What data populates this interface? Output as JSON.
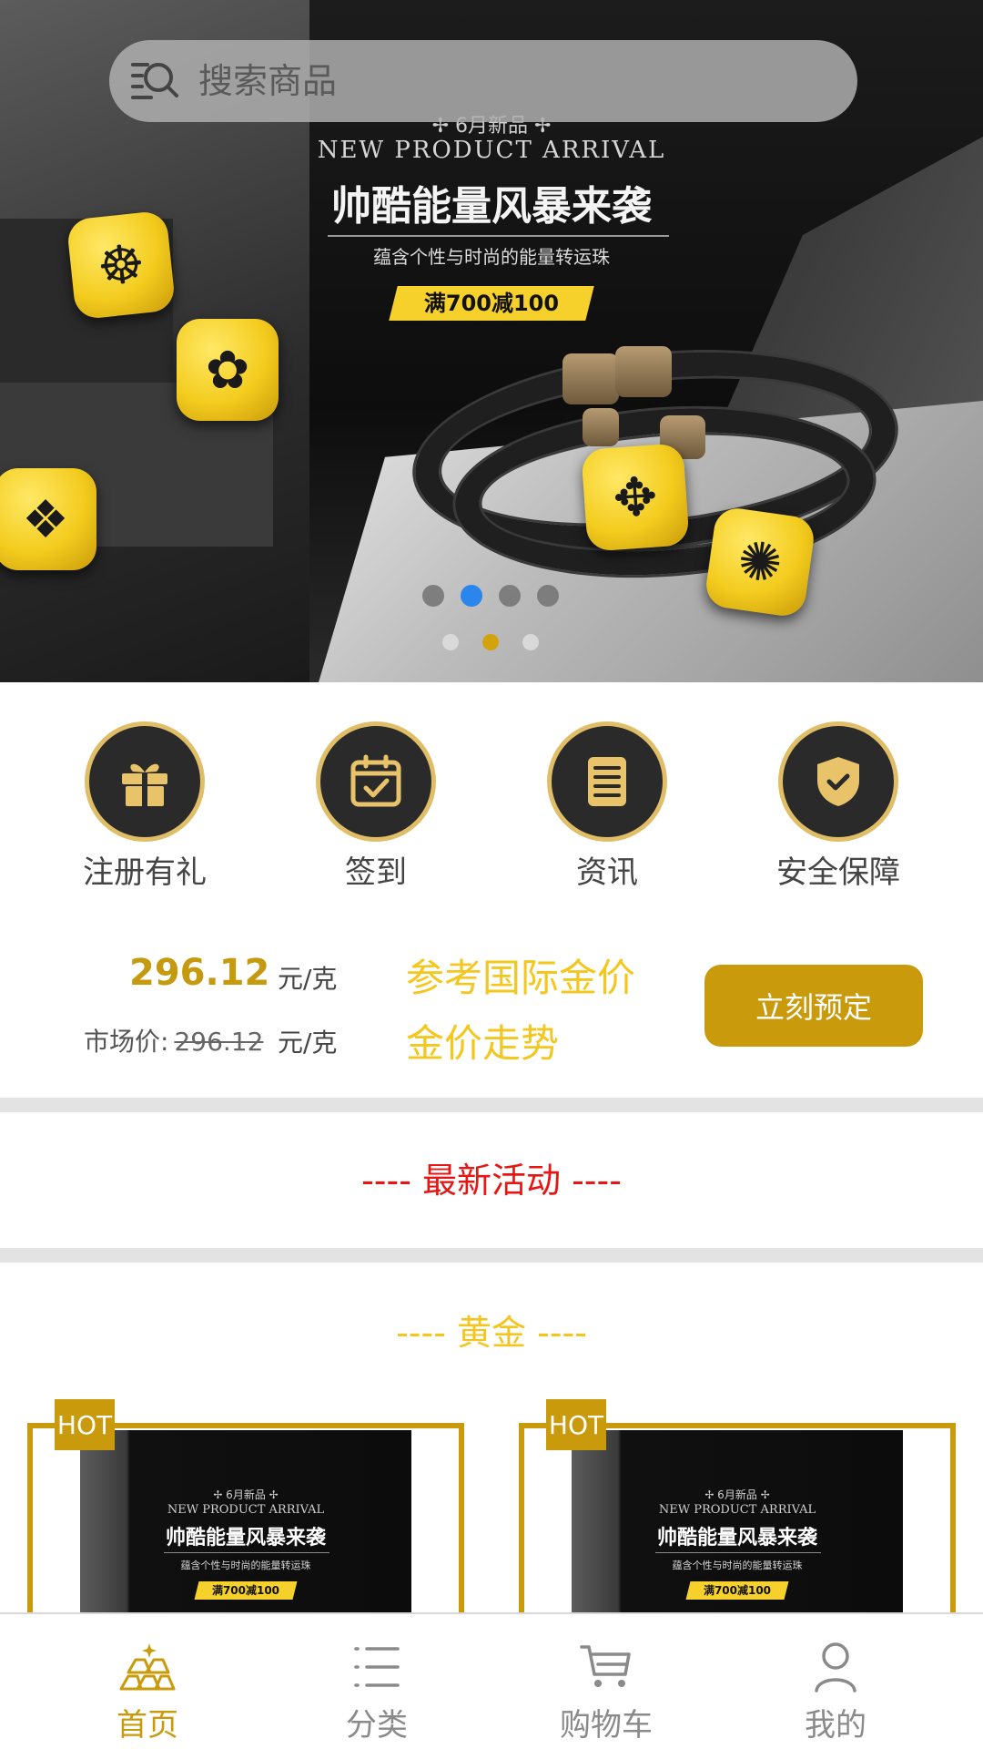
{
  "search": {
    "placeholder": "搜索商品"
  },
  "banner": {
    "sub": "✢ 6月新品 ✢",
    "en": "NEW PRODUCT ARRIVAL",
    "title": "帅酷能量风暴来袭",
    "slogan": "蕴含个性与时尚的能量转运珠",
    "badge": "满700减100",
    "indicator": {
      "slides": 4,
      "active_index": 1,
      "secondary_slides": 3,
      "secondary_active_index": 1
    }
  },
  "features": [
    {
      "label": "注册有礼",
      "icon": "gift-icon"
    },
    {
      "label": "签到",
      "icon": "calendar-check-icon"
    },
    {
      "label": "资讯",
      "icon": "document-icon"
    },
    {
      "label": "安全保障",
      "icon": "shield-check-icon"
    }
  ],
  "gold_price": {
    "price": "296.12",
    "unit": "元/克",
    "market_label": "市场价:",
    "market_price": "296.12",
    "reference_link": "参考国际金价",
    "trend_link": "金价走势",
    "reserve_button": "立刻预定"
  },
  "sections": {
    "activities_title": "---- 最新活动 ----",
    "gold_title": "---- 黄金 ----"
  },
  "products": [
    {
      "badge": "HOT",
      "thumb": {
        "sub": "✢ 6月新品 ✢",
        "en": "NEW PRODUCT ARRIVAL",
        "title": "帅酷能量风暴来袭",
        "slogan": "蕴含个性与时尚的能量转运珠",
        "badge": "满700减100"
      }
    },
    {
      "badge": "HOT",
      "thumb": {
        "sub": "✢ 6月新品 ✢",
        "en": "NEW PRODUCT ARRIVAL",
        "title": "帅酷能量风暴来袭",
        "slogan": "蕴含个性与时尚的能量转运珠",
        "badge": "满700减100"
      }
    }
  ],
  "tabbar": [
    {
      "label": "首页",
      "icon": "home-gold-icon",
      "active": true
    },
    {
      "label": "分类",
      "icon": "list-icon",
      "active": false
    },
    {
      "label": "购物车",
      "icon": "cart-icon",
      "active": false
    },
    {
      "label": "我的",
      "icon": "user-icon",
      "active": false
    }
  ],
  "colors": {
    "accent_gold": "#c99b0c",
    "link_yellow": "#f3c71d",
    "active_dot": "#1a7ef2",
    "section_red": "#e81515"
  }
}
